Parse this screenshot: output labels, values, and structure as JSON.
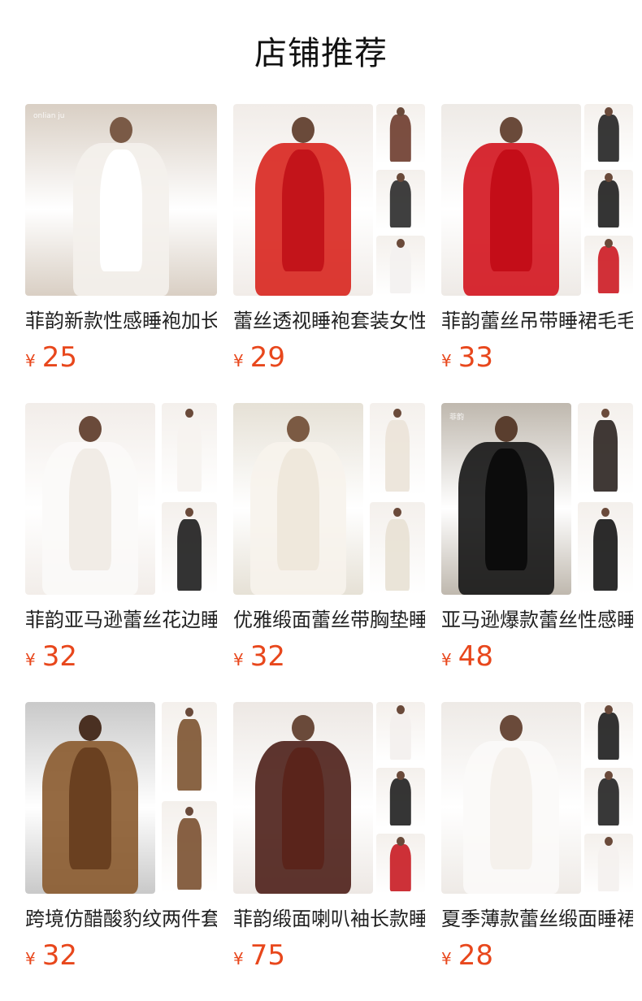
{
  "page": {
    "title": "店铺推荐"
  },
  "products": [
    {
      "title": "菲韵新款性感睡袍加长款",
      "currency": "¥",
      "price": "25",
      "logo": "onlian ju",
      "layout": "single",
      "colors": {
        "bg": "#d9cfc4",
        "robe": "#f4f1ec",
        "body": "#ffffff",
        "head": "#7a5a46"
      }
    },
    {
      "title": "蕾丝透视睡袍套装女性感",
      "currency": "¥",
      "price": "29",
      "logo": "",
      "layout": "multi3",
      "colors": {
        "bg": "#f1ece8",
        "robe": "#d8251e",
        "body": "#c3141a",
        "head": "#6a4a3a"
      },
      "sides": [
        "#6d3b2c",
        "#2a2a2a",
        "#f3f1ef"
      ]
    },
    {
      "title": "菲韵蕾丝吊带睡裙毛毛边",
      "currency": "¥",
      "price": "33",
      "logo": "",
      "layout": "multi3",
      "colors": {
        "bg": "#eeeae6",
        "robe": "#d3141e",
        "body": "#c40d18",
        "head": "#6a4a3a"
      },
      "sides": [
        "#222222",
        "#1e1e1e",
        "#cc1a22"
      ]
    },
    {
      "title": "菲韵亚马逊蕾丝花边睡袍",
      "currency": "¥",
      "price": "32",
      "logo": "",
      "layout": "multi2",
      "colors": {
        "bg": "#f2ede9",
        "robe": "#fbfaf8",
        "body": "#f1ece6",
        "head": "#6a4a3a"
      },
      "sides": [
        "#f6f3ef",
        "#1d1d1d"
      ]
    },
    {
      "title": "优雅缎面蕾丝带胸垫睡裙",
      "currency": "¥",
      "price": "32",
      "logo": "",
      "layout": "multi2",
      "colors": {
        "bg": "#e6e1d6",
        "robe": "#f7f3ec",
        "body": "#efe8dc",
        "head": "#7b5a43"
      },
      "sides": [
        "#ebe3d8",
        "#e8e1d4"
      ]
    },
    {
      "title": "亚马逊爆款蕾丝性感睡袍",
      "currency": "¥",
      "price": "48",
      "logo": "菲韵",
      "layout": "multi2",
      "colors": {
        "bg": "#bfb8ae",
        "robe": "#151515",
        "body": "#0c0c0c",
        "head": "#5a3e2e"
      },
      "sides": [
        "#2b2320",
        "#151515"
      ]
    },
    {
      "title": "跨境仿醋酸豹纹两件套睡",
      "currency": "¥",
      "price": "32",
      "logo": "",
      "layout": "multi2",
      "colors": {
        "bg": "#c9c9c9",
        "robe": "#8a5a2e",
        "body": "#6a4020",
        "head": "#4a3022"
      },
      "sides": [
        "#7c5330",
        "#7a5030"
      ]
    },
    {
      "title": "菲韵缎面喇叭袖长款睡袍",
      "currency": "¥",
      "price": "75",
      "logo": "",
      "layout": "multi3",
      "colors": {
        "bg": "#ede8e4",
        "robe": "#4d1f18",
        "body": "#5a241b",
        "head": "#6a4a3a"
      },
      "sides": [
        "#f3f0ed",
        "#1f1f1f",
        "#c81b22"
      ]
    },
    {
      "title": "夏季薄款蕾丝缎面睡裙",
      "currency": "¥",
      "price": "28",
      "logo": "",
      "layout": "multi3",
      "colors": {
        "bg": "#eeeae6",
        "robe": "#fbfaf8",
        "body": "#f5f1ec",
        "head": "#6a4a3a"
      },
      "sides": [
        "#1d1d1d",
        "#222222",
        "#f4f1ee"
      ]
    }
  ]
}
